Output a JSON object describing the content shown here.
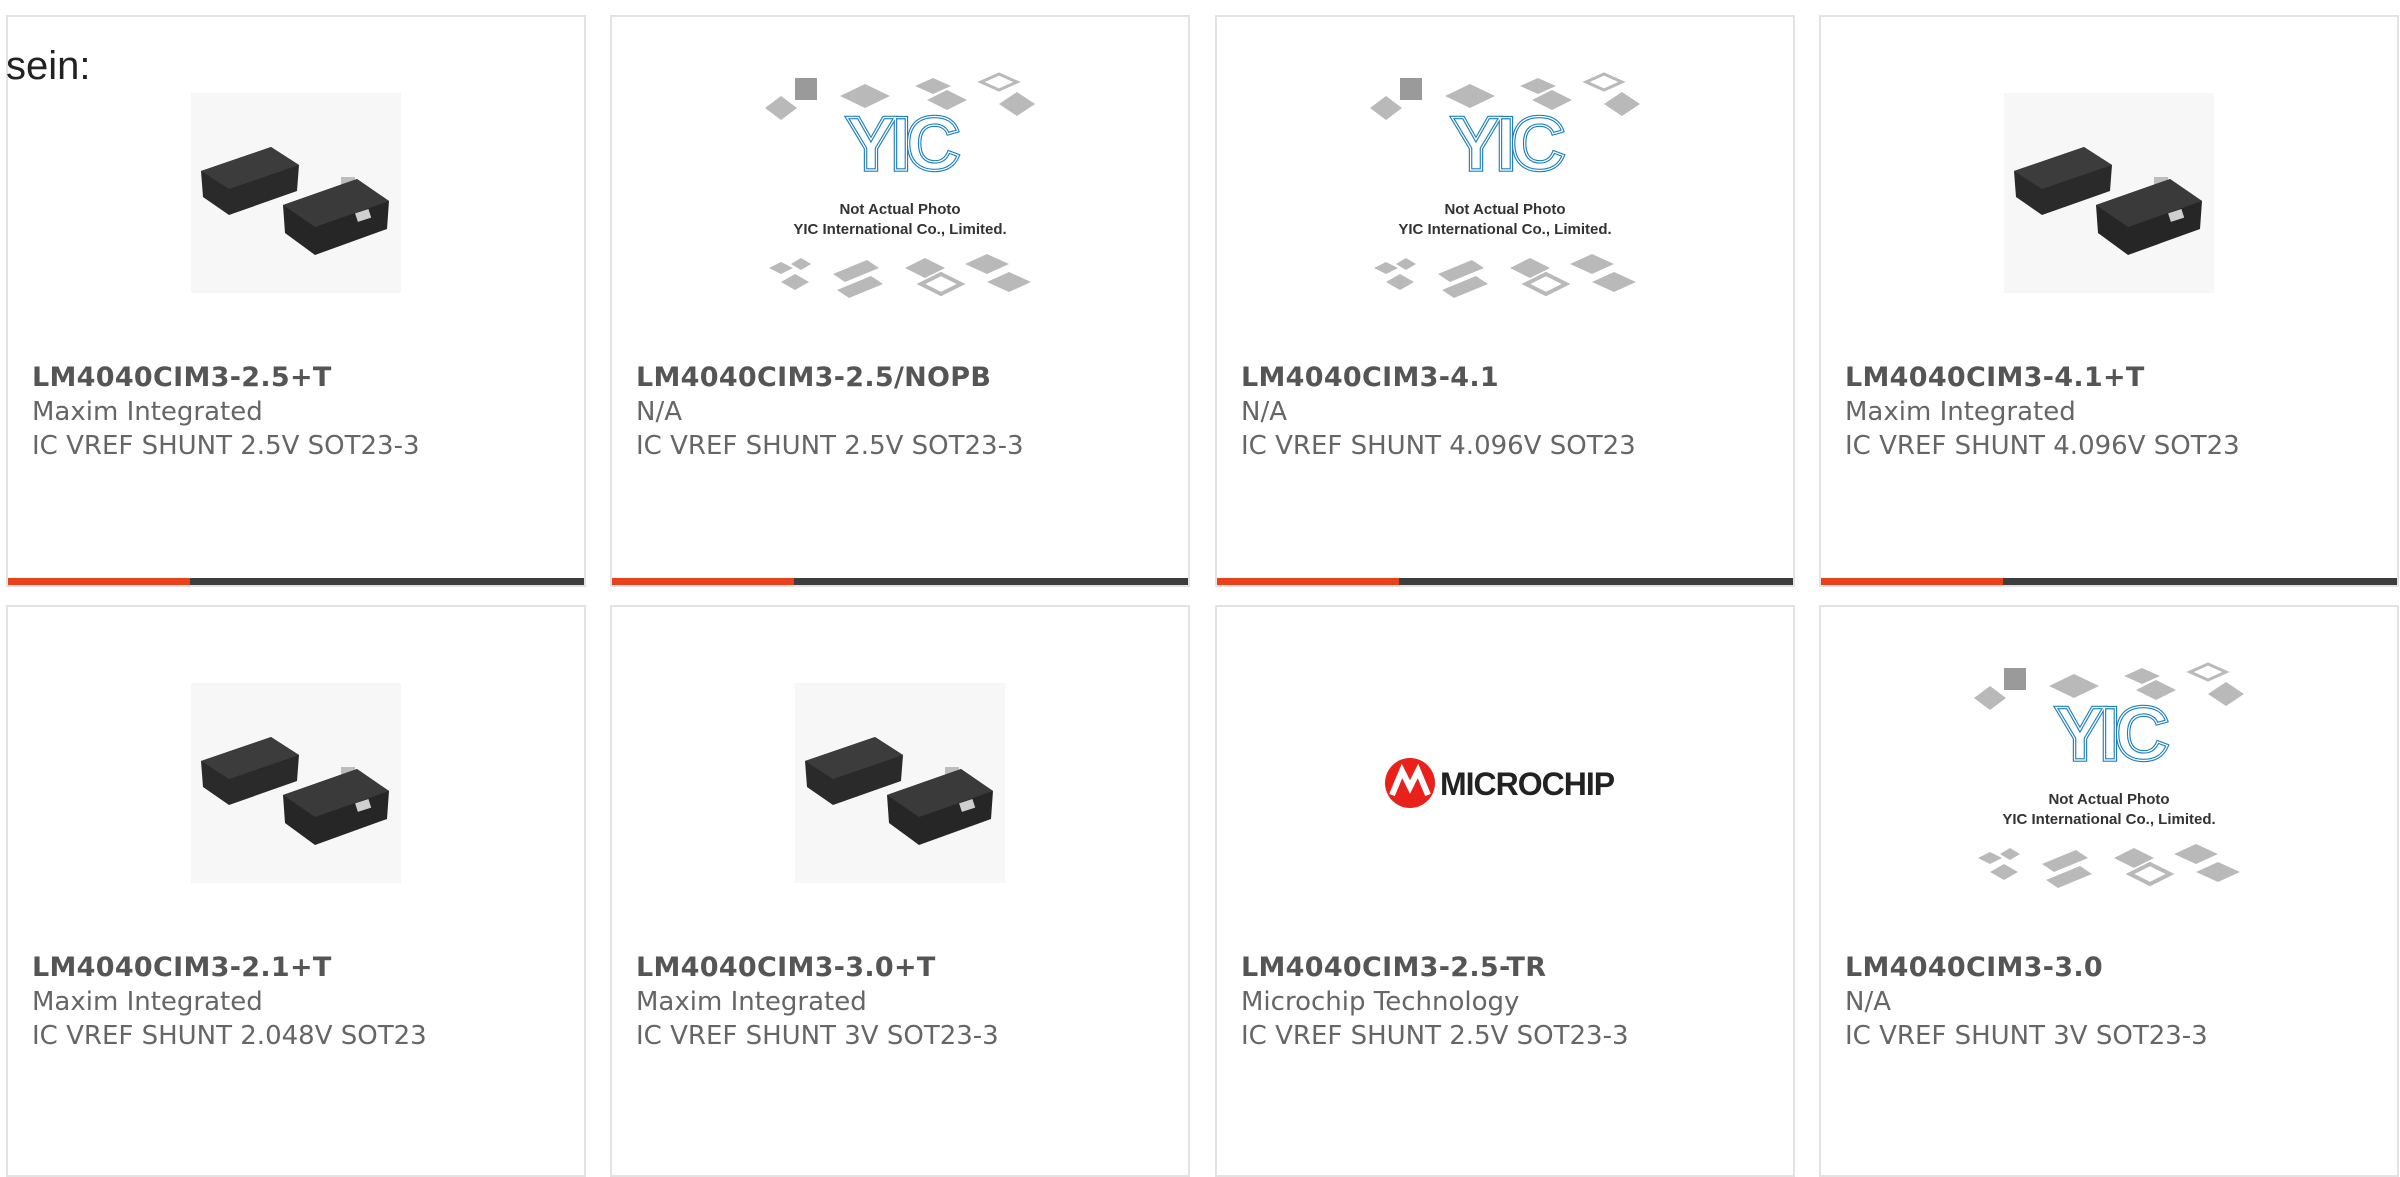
{
  "lead_text": "sein:",
  "colors": {
    "accent": "#e8411b",
    "bar": "#3d3d3d",
    "border": "#e3e3e3",
    "text": "#666666",
    "part_number": "#555555",
    "yic_logo": "#1a7fc1",
    "microchip_red": "#e8211b"
  },
  "placeholder": {
    "line1": "Not Actual Photo",
    "line2": "YIC International Co., Limited.",
    "logo_text": "YIC"
  },
  "microchip_logo_text": "MICROCHIP",
  "products": [
    {
      "part_number": "LM4040CIM3-2.5+T",
      "manufacturer": "Maxim Integrated",
      "description": "IC VREF SHUNT 2.5V SOT23-3",
      "image": "sot23-chip",
      "bar": true
    },
    {
      "part_number": "LM4040CIM3-2.5/NOPB",
      "manufacturer": "N/A",
      "description": "IC VREF SHUNT 2.5V SOT23-3",
      "image": "yic-placeholder",
      "bar": true
    },
    {
      "part_number": "LM4040CIM3-4.1",
      "manufacturer": "N/A",
      "description": "IC VREF SHUNT 4.096V SOT23",
      "image": "yic-placeholder",
      "bar": true
    },
    {
      "part_number": "LM4040CIM3-4.1+T",
      "manufacturer": "Maxim Integrated",
      "description": "IC VREF SHUNT 4.096V SOT23",
      "image": "sot23-chip",
      "bar": true
    },
    {
      "part_number": "LM4040CIM3-2.1+T",
      "manufacturer": "Maxim Integrated",
      "description": "IC VREF SHUNT 2.048V SOT23",
      "image": "sot23-chip",
      "bar": false
    },
    {
      "part_number": "LM4040CIM3-3.0+T",
      "manufacturer": "Maxim Integrated",
      "description": "IC VREF SHUNT 3V SOT23-3",
      "image": "sot23-chip",
      "bar": false
    },
    {
      "part_number": "LM4040CIM3-2.5-TR",
      "manufacturer": "Microchip Technology",
      "description": "IC VREF SHUNT 2.5V SOT23-3",
      "image": "microchip-logo",
      "bar": false
    },
    {
      "part_number": "LM4040CIM3-3.0",
      "manufacturer": "N/A",
      "description": "IC VREF SHUNT 3V SOT23-3",
      "image": "yic-placeholder",
      "bar": false
    }
  ]
}
